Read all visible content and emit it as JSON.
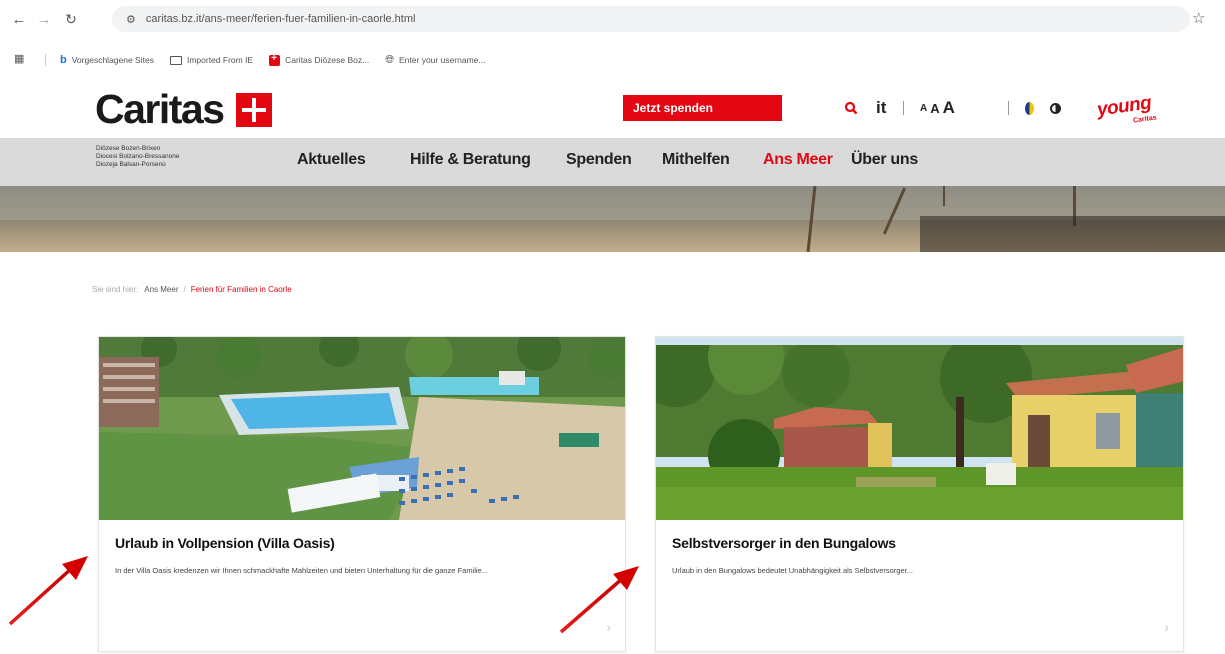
{
  "browser": {
    "url": "caritas.bz.it/ans-meer/ferien-fuer-familien-in-caorle.html",
    "bookmarks": [
      "Vorgeschlagene Sites",
      "Imported From IE",
      "Caritas Diözese Boz...",
      "Enter your username..."
    ]
  },
  "header": {
    "logo_text": "Caritas",
    "donate_label": "Jetzt spenden",
    "lang_label": "it",
    "fontsize_small": "A",
    "fontsize_medium": "A",
    "fontsize_large": "A",
    "young_label": "young",
    "young_sub": "Caritas"
  },
  "nav": {
    "diocese": [
      "Diözese Bozen-Brixen",
      "Diocesi Bolzano-Bressanone",
      "Diozeja Balsan-Porsenù"
    ],
    "items": [
      "Aktuelles",
      "Hilfe & Beratung",
      "Spenden",
      "Mithelfen",
      "Ans Meer",
      "Über uns"
    ],
    "active": "Ans Meer"
  },
  "breadcrumb": {
    "label": "Sie sind hier:",
    "home": "Ans Meer",
    "separator": "/",
    "current": "Ferien für Familien in Caorle"
  },
  "cards": [
    {
      "title": "Urlaub in Vollpension (Villa Oasis)",
      "text": "In der Villa Oasis kredenzen wir Ihnen schmackhafte Mahlzeiten und bieten Unterhaltung für die ganze Familie..."
    },
    {
      "title": "Selbstversorger in den Bungalows",
      "text": "Urlaub in den Bungalows bedeutet Unabhängigkeit als Selbstversorger..."
    }
  ],
  "colors": {
    "brand_red": "#e30613",
    "nav_bg": "#dadada"
  }
}
